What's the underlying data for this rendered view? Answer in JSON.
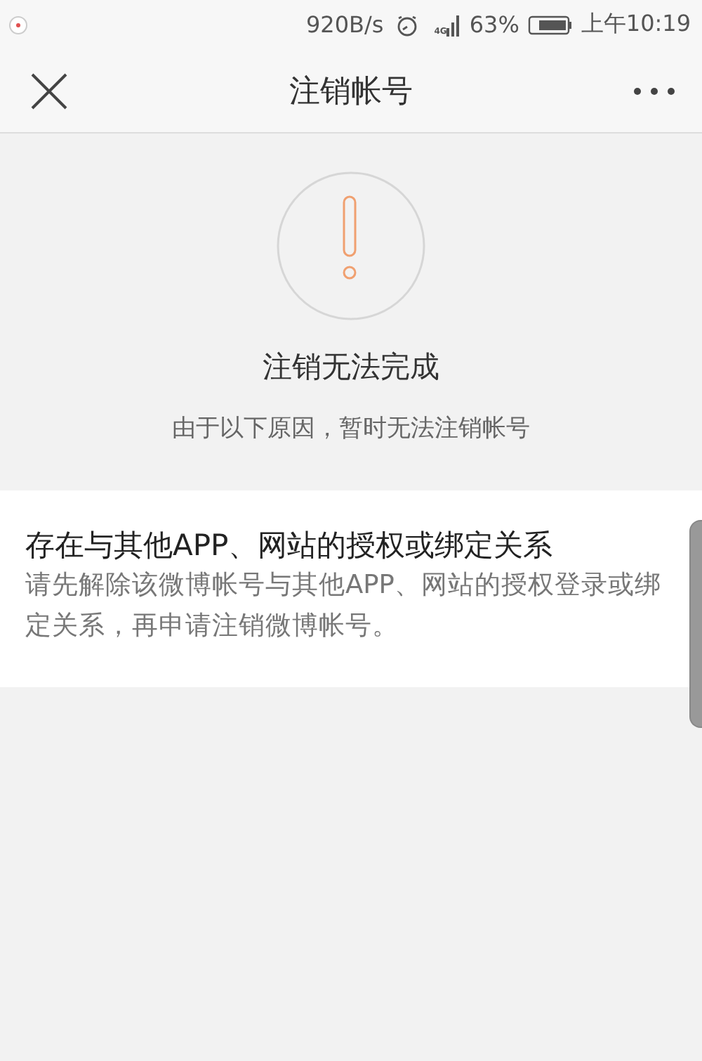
{
  "status_bar": {
    "speed": "920B/s",
    "network": "4G",
    "battery": "63%",
    "time": "上午10:19"
  },
  "nav_bar": {
    "title": "注销帐号"
  },
  "notice": {
    "title": "注销无法完成",
    "subtitle": "由于以下原因，暂时无法注销帐号"
  },
  "reasons": [
    {
      "title": "存在与其他APP、网站的授权或绑定关系",
      "detail": "请先解除该微博帐号与其他APP、网站的授权登录或绑定关系，再申请注销微博帐号。"
    }
  ]
}
